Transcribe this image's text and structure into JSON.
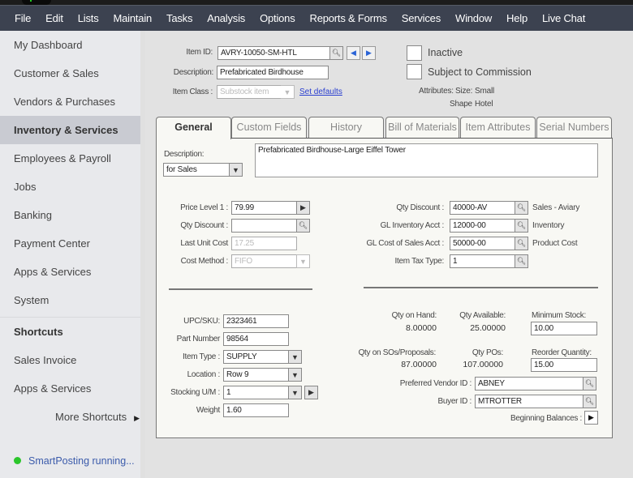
{
  "menubar": {
    "items": [
      "File",
      "Edit",
      "Lists",
      "Maintain",
      "Tasks",
      "Analysis",
      "Options",
      "Reports & Forms",
      "Services",
      "Window",
      "Help",
      "Live Chat"
    ]
  },
  "sidebar": {
    "items": [
      {
        "label": "My Dashboard",
        "active": false
      },
      {
        "label": "Customer & Sales",
        "active": false
      },
      {
        "label": "Vendors & Purchases",
        "active": false
      },
      {
        "label": "Inventory & Services",
        "active": true
      },
      {
        "label": "Employees & Payroll",
        "active": false
      },
      {
        "label": "Jobs",
        "active": false
      },
      {
        "label": "Banking",
        "active": false
      },
      {
        "label": "Payment Center",
        "active": false
      },
      {
        "label": "Apps & Services",
        "active": false
      },
      {
        "label": "System",
        "active": false
      }
    ],
    "shortcuts_title": "Shortcuts",
    "shortcuts": [
      "Sales Invoice",
      "Apps & Services"
    ],
    "more_shortcuts": "More Shortcuts",
    "status": "SmartPosting running..."
  },
  "header": {
    "item_id_label": "Item ID:",
    "item_id": "AVRY-10050-SM-HTL",
    "description_label": "Description:",
    "description": "Prefabricated Birdhouse",
    "item_class_label": "Item Class :",
    "item_class": "Substock item",
    "set_defaults": "Set defaults",
    "inactive_label": "Inactive",
    "inactive_checked": false,
    "commission_label": "Subject to Commission",
    "commission_checked": false,
    "attributes_label": "Attributes:",
    "size_label": "Size:",
    "size_value": "Small",
    "shape_label": "Shape",
    "shape_value": "Hotel"
  },
  "tabs": [
    {
      "label": "General",
      "active": true
    },
    {
      "label": "Custom Fields",
      "active": false
    },
    {
      "label": "History",
      "active": false
    },
    {
      "label": "Bill of Materials",
      "active": false
    },
    {
      "label": "Item Attributes",
      "active": false
    },
    {
      "label": "Serial Numbers",
      "active": false
    }
  ],
  "general": {
    "description_label": "Description:",
    "description_for": "for Sales",
    "description_text": "Prefabricated Birdhouse-Large Eiffel Tower",
    "price_level_label": "Price Level 1 :",
    "price_level": "79.99",
    "qty_discount_label": "Qty Discount :",
    "qty_discount": "",
    "last_unit_cost_label": "Last Unit Cost",
    "last_unit_cost": "17.25",
    "cost_method_label": "Cost Method :",
    "cost_method": "FIFO",
    "gl_sales_label": "Qty Discount :",
    "gl_sales": "40000-AV",
    "gl_sales_desc": "Sales - Aviary",
    "gl_inventory_label": "GL Inventory Acct :",
    "gl_inventory": "12000-00",
    "gl_inventory_desc": "Inventory",
    "gl_cos_label": "GL Cost of Sales Acct :",
    "gl_cos": "50000-00",
    "gl_cos_desc": "Product Cost",
    "tax_type_label": "Item Tax Type:",
    "tax_type": "1",
    "upc_label": "UPC/SKU:",
    "upc": "2323461",
    "part_number_label": "Part Number",
    "part_number": "98564",
    "item_type_label": "Item Type :",
    "item_type": "SUPPLY",
    "location_label": "Location :",
    "location": "Row 9",
    "stocking_um_label": "Stocking U/M :",
    "stocking_um": "1",
    "weight_label": "Weight",
    "weight": "1.60",
    "qty_on_hand_label": "Qty on Hand:",
    "qty_on_hand": "8.00000",
    "qty_available_label": "Qty Available:",
    "qty_available": "25.00000",
    "min_stock_label": "Minimum Stock:",
    "min_stock": "10.00",
    "qty_sos_label": "Qty on SOs/Proposals:",
    "qty_sos": "87.00000",
    "qty_pos_label": "Qty POs:",
    "qty_pos": "107.00000",
    "reorder_label": "Reorder Quantity:",
    "reorder": "15.00",
    "vendor_label": "Preferred Vendor ID :",
    "vendor": "ABNEY",
    "buyer_label": "Buyer ID :",
    "buyer": "MTROTTER",
    "beginning_balances_label": "Beginning Balances :"
  }
}
